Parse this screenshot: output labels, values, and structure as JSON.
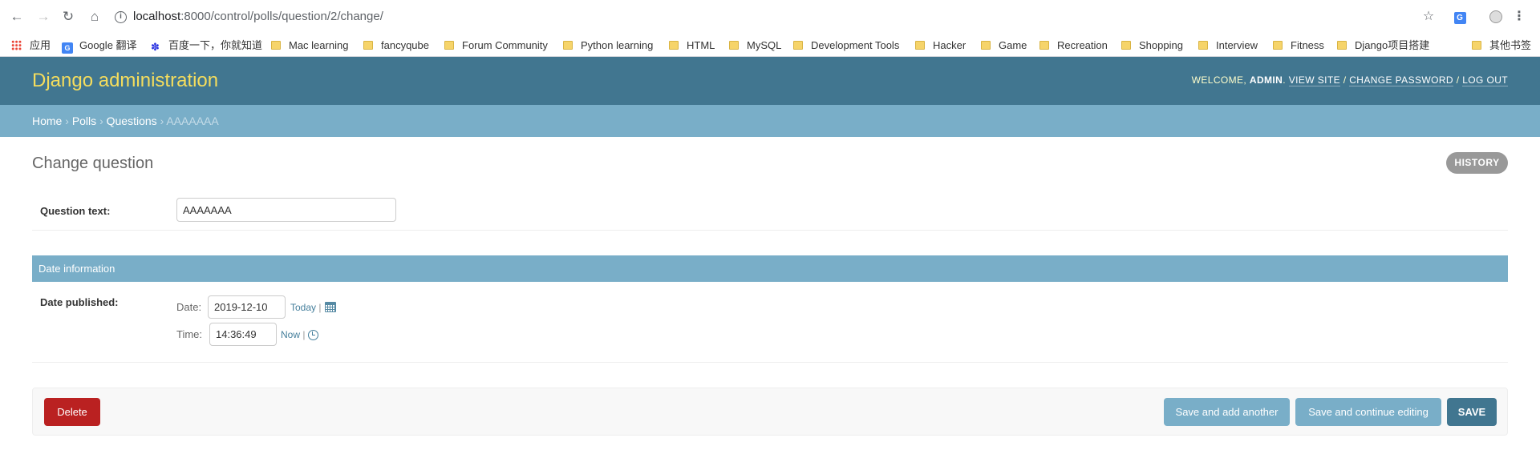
{
  "browser": {
    "url_host": "localhost",
    "url_path": ":8000/control/polls/question/2/change/",
    "bookmarks": [
      {
        "label": "应用",
        "icon": "apps-grid-icon"
      },
      {
        "label": "Google 翻译",
        "icon": "google-translate-icon"
      },
      {
        "label": "百度一下，你就知道",
        "icon": "baidu-paw-icon"
      },
      {
        "label": "Mac learning",
        "icon": "folder-icon"
      },
      {
        "label": "fancyqube",
        "icon": "folder-icon"
      },
      {
        "label": "Forum Community",
        "icon": "folder-icon"
      },
      {
        "label": "Python learning",
        "icon": "folder-icon"
      },
      {
        "label": "HTML",
        "icon": "folder-icon"
      },
      {
        "label": "MySQL",
        "icon": "folder-icon"
      },
      {
        "label": "Development Tools",
        "icon": "folder-icon"
      },
      {
        "label": "Hacker",
        "icon": "folder-icon"
      },
      {
        "label": "Game",
        "icon": "folder-icon"
      },
      {
        "label": "Recreation",
        "icon": "folder-icon"
      },
      {
        "label": "Shopping",
        "icon": "folder-icon"
      },
      {
        "label": "Interview",
        "icon": "folder-icon"
      },
      {
        "label": "Fitness",
        "icon": "folder-icon"
      },
      {
        "label": "Django项目搭建",
        "icon": "folder-icon"
      },
      {
        "label": "其他书签",
        "icon": "folder-icon"
      }
    ]
  },
  "header": {
    "branding": "Django administration",
    "welcome": "Welcome,",
    "user": "admin",
    "view_site": "View site",
    "change_password": "Change password",
    "log_out": "Log out",
    "sep": "/"
  },
  "breadcrumbs": {
    "home": "Home",
    "polls": "Polls",
    "questions": "Questions",
    "current": "AAAAAAA",
    "sep": "›"
  },
  "content": {
    "title": "Change question",
    "history": "History"
  },
  "form": {
    "question_text_label": "Question text:",
    "question_text_value": "AAAAAAA",
    "fieldset_title": "Date information",
    "date_published_label": "Date published:",
    "date_label": "Date:",
    "date_value": "2019-12-10",
    "today_link": "Today",
    "time_label": "Time:",
    "time_value": "14:36:49",
    "now_link": "Now",
    "link_sep": "|"
  },
  "submit": {
    "delete": "Delete",
    "save_add_another": "Save and add another",
    "save_continue": "Save and continue editing",
    "save": "Save"
  },
  "colors": {
    "header_bg": "#417690",
    "branding": "#f5dd5d",
    "breadcrumbs_bg": "#79aec8",
    "delete_bg": "#ba2121",
    "button_light_bg": "#79aec8",
    "save_bg": "#417690"
  }
}
